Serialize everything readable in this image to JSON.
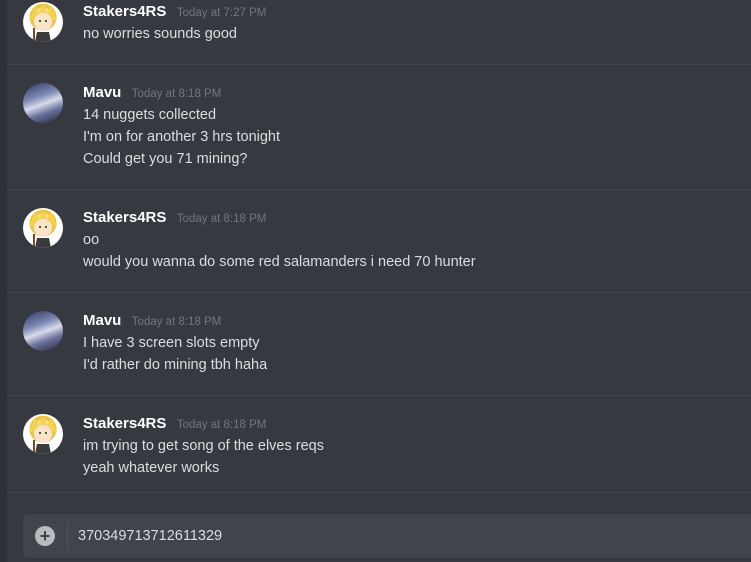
{
  "messages": [
    {
      "username": "Stakers4RS",
      "timestamp": "Today at 7:27 PM",
      "avatar": "anime-avatar",
      "lines": [
        "no worries sounds good"
      ]
    },
    {
      "username": "Mavu",
      "timestamp": "Today at 8:18 PM",
      "avatar": "cloud-avatar",
      "lines": [
        "14 nuggets collected",
        "I'm on for another 3 hrs tonight",
        "Could get you 71 mining?"
      ]
    },
    {
      "username": "Stakers4RS",
      "timestamp": "Today at 8:18 PM",
      "avatar": "anime-avatar",
      "lines": [
        "oo",
        "would you wanna do some red salamanders i need 70 hunter"
      ]
    },
    {
      "username": "Mavu",
      "timestamp": "Today at 8:18 PM",
      "avatar": "cloud-avatar",
      "lines": [
        "I have 3 screen slots empty",
        "I'd rather do mining tbh haha"
      ]
    },
    {
      "username": "Stakers4RS",
      "timestamp": "Today at 8:18 PM",
      "avatar": "anime-avatar",
      "lines": [
        "im trying to get song of the elves reqs",
        "yeah whatever works"
      ]
    }
  ],
  "composer": {
    "value": "370349713712611329",
    "attach_icon": "plus-circle-icon"
  },
  "colors": {
    "background": "#36393f",
    "composer": "#40444b",
    "username": "#ffffff",
    "timestamp": "#72767d",
    "text": "#dcddde"
  }
}
